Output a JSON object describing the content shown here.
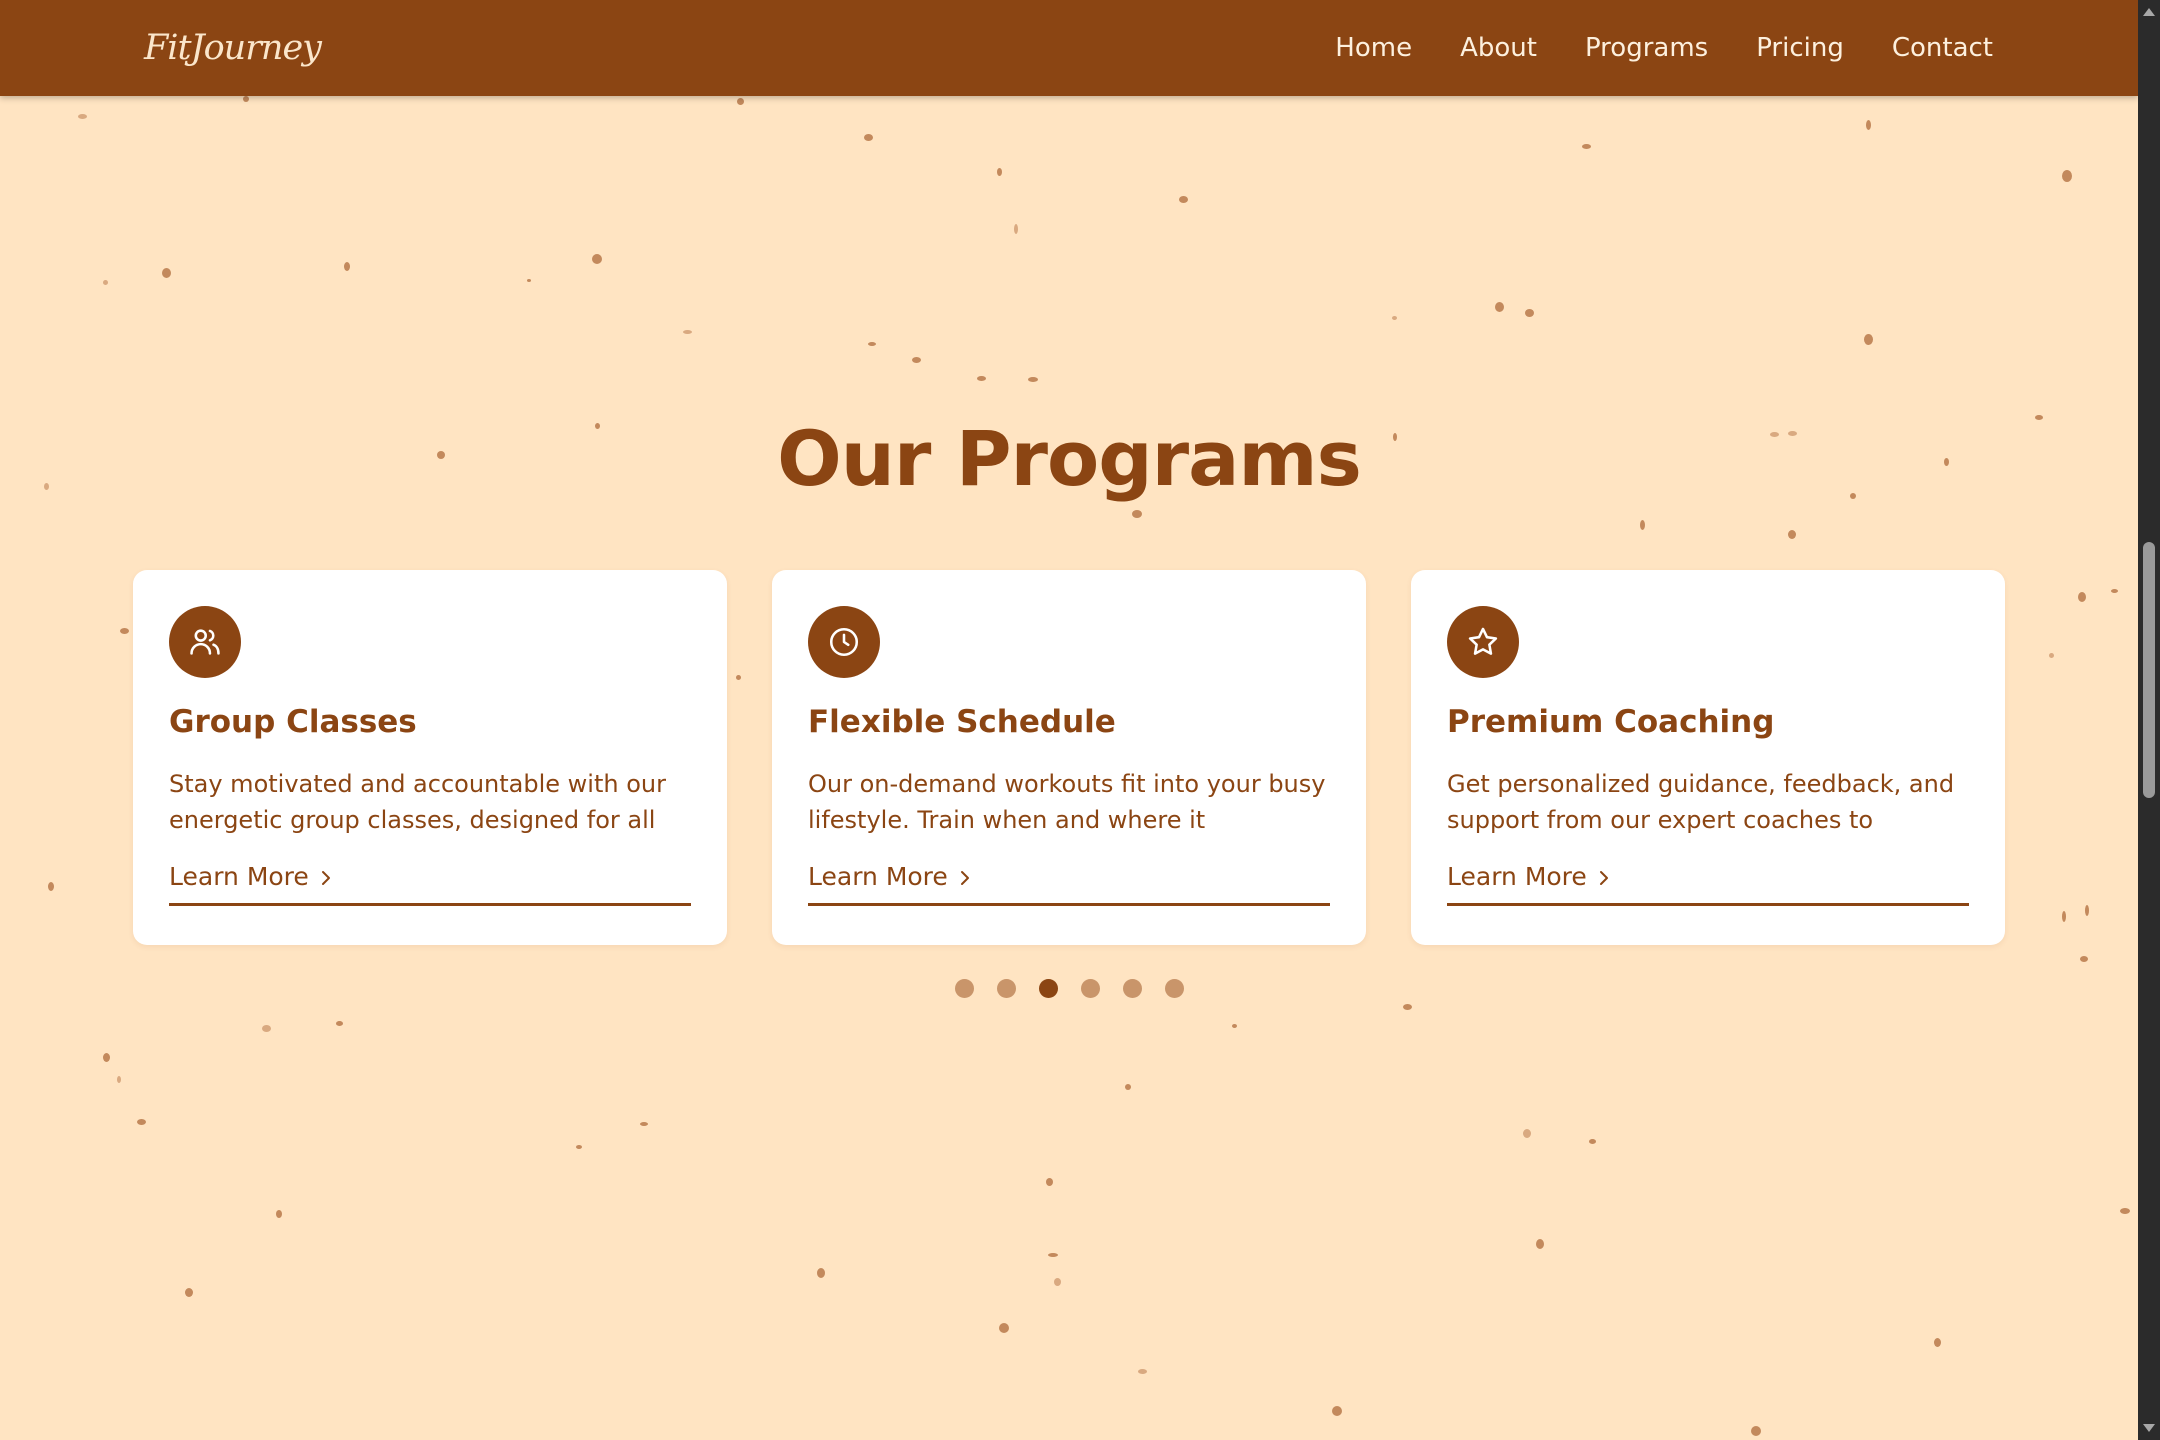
{
  "header": {
    "logo": "FitJourney",
    "nav": [
      "Home",
      "About",
      "Programs",
      "Pricing",
      "Contact"
    ]
  },
  "section": {
    "title": "Our Programs"
  },
  "cards": [
    {
      "icon": "users-icon",
      "title": "Group Classes",
      "text": "Stay motivated and accountable with our energetic group classes, designed for all",
      "link": "Learn More"
    },
    {
      "icon": "clock-icon",
      "title": "Flexible Schedule",
      "text": "Our on-demand workouts fit into your busy lifestyle. Train when and where it",
      "link": "Learn More"
    },
    {
      "icon": "star-icon",
      "title": "Premium Coaching",
      "text": "Get personalized guidance, feedback, and support from our expert coaches to",
      "link": "Learn More"
    }
  ],
  "carousel": {
    "slides": 6,
    "active_slide": 3
  },
  "colors": {
    "primary": "#8b4513",
    "background": "#ffe4c2",
    "card": "#ffffff",
    "dot_inactive": "#c9956a"
  }
}
